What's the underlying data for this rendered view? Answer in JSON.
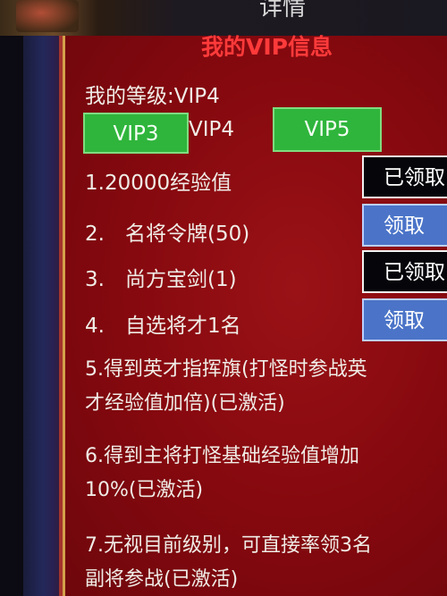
{
  "header": {
    "partial_title": "详情"
  },
  "vip_panel": {
    "title": "我的VIP信息",
    "level_text": "我的等级:VIP4",
    "tiers": {
      "prev": "VIP3",
      "current": "VIP4",
      "next": "VIP5"
    },
    "rewards": [
      {
        "text": "1.20000经验值",
        "action": "已领取",
        "status": "claimed"
      },
      {
        "num": "2.",
        "text": "名将令牌(50)",
        "action": "领取",
        "status": "claimable"
      },
      {
        "num": "3.",
        "text": "尚方宝剑(1)",
        "action": "已领取",
        "status": "claimed"
      },
      {
        "num": "4.",
        "text": "自选将才1名",
        "action": "领取",
        "status": "claimable"
      }
    ],
    "perks": [
      {
        "line1": "5.得到英才指挥旗(打怪时参战英",
        "line2": "才经验值加倍)(已激活)"
      },
      {
        "line1": "6.得到主将打怪基础经验值增加",
        "line2": "10%(已激活)"
      },
      {
        "line1": "7.无视目前级别，可直接率领3名",
        "line2": "副将参战(已激活)"
      }
    ]
  },
  "colors": {
    "panel_bg": "#86090f",
    "title": "#ff3a3a",
    "vip_button": "#2fb53c",
    "claim_button": "#4b74c8",
    "claimed_button": "#05050a"
  }
}
